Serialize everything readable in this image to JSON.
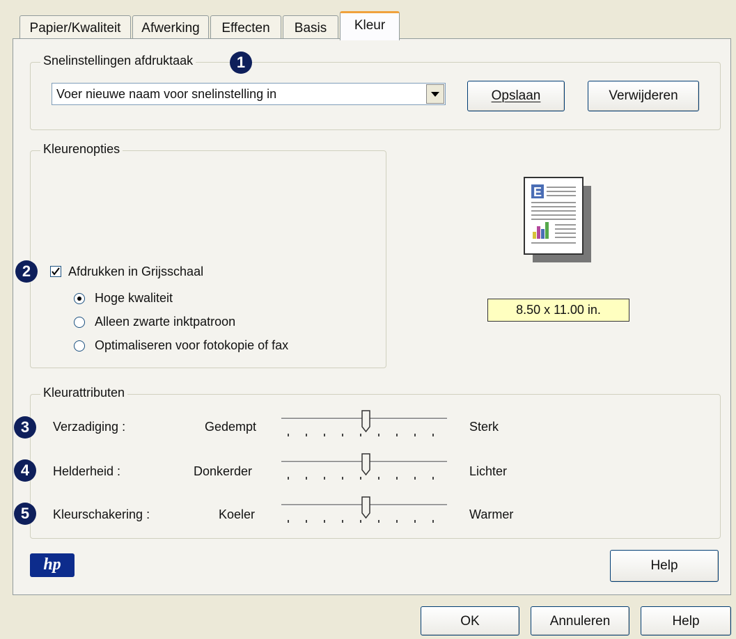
{
  "tabs": [
    {
      "label": "Papier/Kwaliteit",
      "active": false
    },
    {
      "label": "Afwerking",
      "active": false
    },
    {
      "label": "Effecten",
      "active": false
    },
    {
      "label": "Basis",
      "active": false
    },
    {
      "label": "Kleur",
      "active": true
    }
  ],
  "quick_settings": {
    "legend": "Snelinstellingen afdruktaak",
    "dropdown_value": "Voer nieuwe naam voor snelinstelling in",
    "save_label": "Opslaan",
    "delete_label": "Verwijderen"
  },
  "color_options": {
    "legend": "Kleurenopties",
    "grayscale_label": "Afdrukken in Grijsschaal",
    "grayscale_checked": true,
    "radios": [
      {
        "label": "Hoge kwaliteit",
        "selected": true
      },
      {
        "label": "Alleen zwarte inktpatroon",
        "selected": false
      },
      {
        "label": "Optimaliseren voor fotokopie of fax",
        "selected": false
      }
    ]
  },
  "preview": {
    "page_size": "8.50 x 11.00 in."
  },
  "color_attributes": {
    "legend": "Kleurattributen",
    "sliders": [
      {
        "label": "Verzadiging :",
        "min_label": "Gedempt",
        "max_label": "Sterk",
        "value": 0.5
      },
      {
        "label": "Helderheid :",
        "min_label": "Donkerder",
        "max_label": "Lichter",
        "value": 0.5
      },
      {
        "label": "Kleurschakering :",
        "min_label": "Koeler",
        "max_label": "Warmer",
        "value": 0.5
      }
    ]
  },
  "callouts": [
    "1",
    "2",
    "3",
    "4",
    "5"
  ],
  "logo": "hp",
  "buttons": {
    "help_inner": "Help",
    "ok": "OK",
    "cancel": "Annuleren",
    "help": "Help"
  },
  "colors": {
    "accent_tab": "#F0A23C",
    "callout_bg": "#0E1F5B",
    "size_box_bg": "#FFFFC0"
  }
}
